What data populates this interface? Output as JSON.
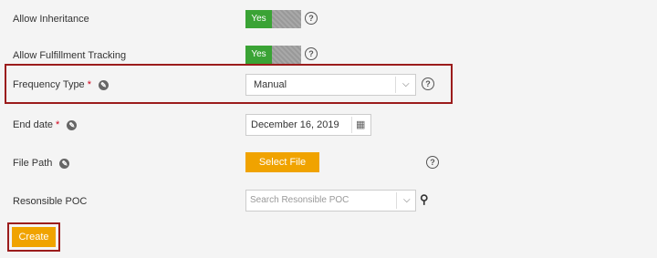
{
  "form": {
    "inheritance": {
      "label": "Allow Inheritance",
      "toggle_on": "Yes",
      "help": "?"
    },
    "fulfillment": {
      "label": "Allow Fulfillment Tracking",
      "toggle_on": "Yes",
      "help": "?"
    },
    "frequency": {
      "label": "Frequency Type",
      "required": "*",
      "value": "Manual",
      "help": "?"
    },
    "end_date": {
      "label": "End date",
      "required": "*",
      "value": "December 16, 2019"
    },
    "file_path": {
      "label": "File Path",
      "button": "Select File",
      "help": "?"
    },
    "poc": {
      "label": "Resonsible POC",
      "placeholder": "Search Resonsible POC"
    }
  },
  "actions": {
    "create": "Create"
  },
  "colors": {
    "toggle_on": "#3aa335",
    "button": "#f0a300",
    "highlight": "#9b1c1c"
  }
}
